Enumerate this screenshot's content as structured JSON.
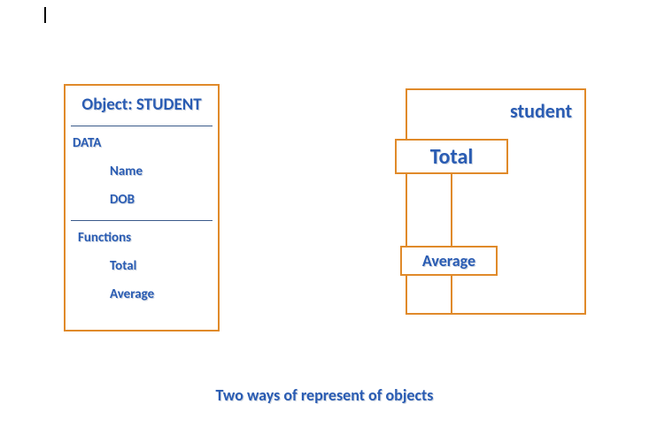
{
  "leftObject": {
    "title": "Object: STUDENT",
    "dataHeader": "DATA",
    "dataItems": {
      "name": "Name",
      "dob": "DOB"
    },
    "funcHeader": "Functions",
    "funcItems": {
      "total": "Total",
      "average": "Average"
    }
  },
  "rightObject": {
    "title": "student",
    "totalLabel": "Total",
    "averageLabel": "Average"
  },
  "caption": "Two ways of represent of objects"
}
